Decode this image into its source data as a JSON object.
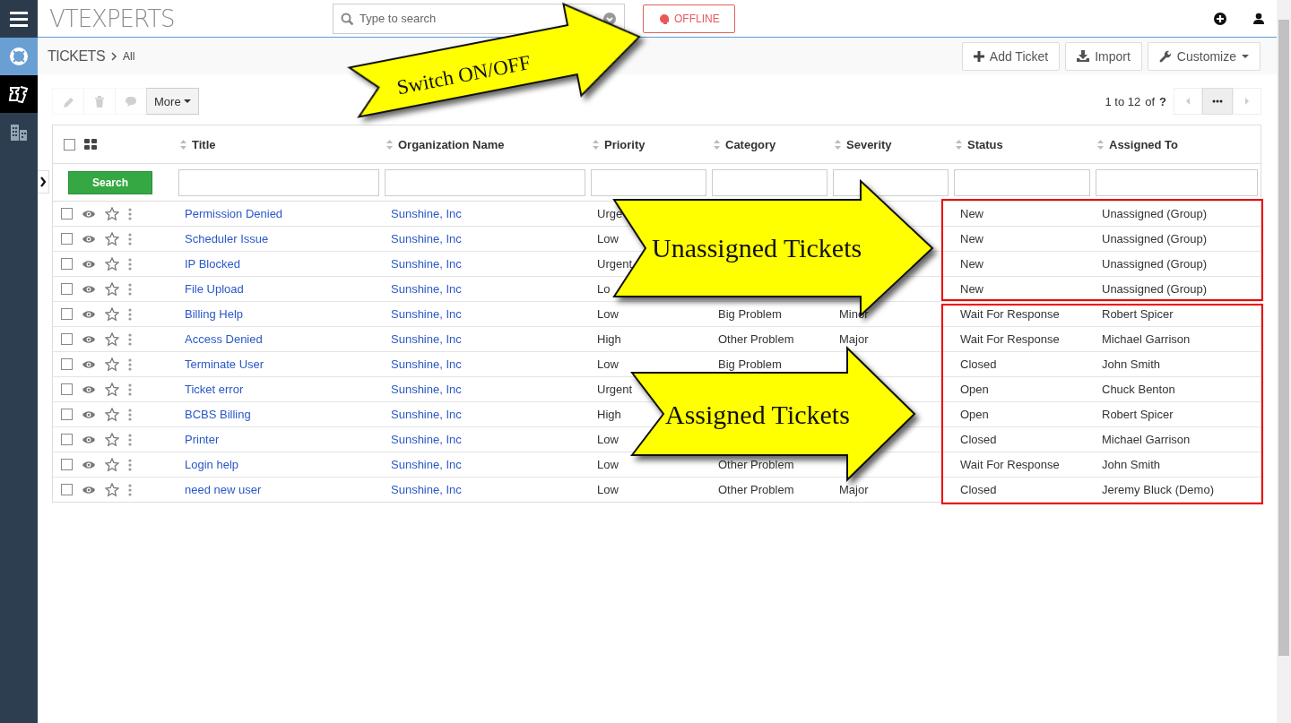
{
  "sidebar": {
    "items": [
      {
        "kind": "app",
        "selected": false
      },
      {
        "kind": "module",
        "selected": true
      },
      {
        "kind": "module",
        "selected": false
      }
    ]
  },
  "header": {
    "logo": "VTEXPERTS",
    "search": {
      "placeholder": "Type to search"
    },
    "status_button": {
      "label": "OFFLINE",
      "online": false
    }
  },
  "breadcrumb": {
    "module": "TICKETS",
    "view": "All"
  },
  "actions": [
    {
      "label": "Add Ticket",
      "kind": "add"
    },
    {
      "label": "Import",
      "kind": "import"
    },
    {
      "label": "Customize",
      "kind": "dropdown"
    }
  ],
  "toolbar": {
    "buttons": [
      {
        "disabled": true
      },
      {
        "disabled": true
      },
      {
        "disabled": true
      }
    ],
    "more": "More"
  },
  "pagination": {
    "range": "1 to 12",
    "of": "of",
    "total": "?"
  },
  "table": {
    "select_all": {
      "checked": false
    },
    "columns": [
      "Title",
      "Organization Name",
      "Priority",
      "Category",
      "Severity",
      "Status",
      "Assigned To"
    ],
    "search_button": "Search",
    "rows": [
      {
        "checked": false,
        "title": "Permission Denied",
        "organization": "Sunshine, Inc",
        "priority": "Urge",
        "status": "New",
        "assigned_to": "Unassigned (Group)"
      },
      {
        "checked": false,
        "title": "Scheduler Issue",
        "organization": "Sunshine, Inc",
        "priority": "Low",
        "status": "New",
        "assigned_to": "Unassigned (Group)"
      },
      {
        "checked": false,
        "title": "IP Blocked",
        "organization": "Sunshine, Inc",
        "priority": "Urgent",
        "status": "New",
        "assigned_to": "Unassigned (Group)"
      },
      {
        "checked": false,
        "title": "File Upload",
        "organization": "Sunshine, Inc",
        "priority": "Lo",
        "status": "New",
        "assigned_to": "Unassigned (Group)"
      },
      {
        "checked": false,
        "title": "Billing Help",
        "organization": "Sunshine, Inc",
        "priority": "Low",
        "category": "Big Problem",
        "severity": "Minor",
        "status": "Wait For Response",
        "assigned_to": "Robert Spicer"
      },
      {
        "checked": false,
        "title": "Access Denied",
        "organization": "Sunshine, Inc",
        "priority": "High",
        "category": "Other Problem",
        "severity": "Major",
        "status": "Wait For Response",
        "assigned_to": "Michael Garrison"
      },
      {
        "checked": false,
        "title": "Terminate User",
        "organization": "Sunshine, Inc",
        "priority": "Low",
        "category": "Big Problem",
        "status": "Closed",
        "assigned_to": "John Smith"
      },
      {
        "checked": false,
        "title": "Ticket error",
        "organization": "Sunshine, Inc",
        "priority": "Urgent",
        "status": "Open",
        "assigned_to": "Chuck Benton"
      },
      {
        "checked": false,
        "title": "BCBS Billing",
        "organization": "Sunshine, Inc",
        "priority": "High",
        "status": "Open",
        "assigned_to": "Robert Spicer"
      },
      {
        "checked": false,
        "title": "Printer",
        "organization": "Sunshine, Inc",
        "priority": "Low",
        "status": "Closed",
        "assigned_to": "Michael Garrison"
      },
      {
        "checked": false,
        "title": "Login help",
        "organization": "Sunshine, Inc",
        "priority": "Low",
        "category": "Other Problem",
        "status": "Wait For Response",
        "assigned_to": "John Smith"
      },
      {
        "checked": false,
        "title": "need new user",
        "organization": "Sunshine, Inc",
        "priority": "Low",
        "category": "Other Problem",
        "severity": "Major",
        "status": "Closed",
        "assigned_to": "Jeremy Bluck (Demo)"
      }
    ]
  },
  "annotations": [
    {
      "label": "Switch ON/OFF",
      "kind": "arrow"
    },
    {
      "label": "Unassigned Tickets",
      "kind": "framed"
    },
    {
      "label": "Assigned Tickets",
      "kind": "framed"
    }
  ]
}
